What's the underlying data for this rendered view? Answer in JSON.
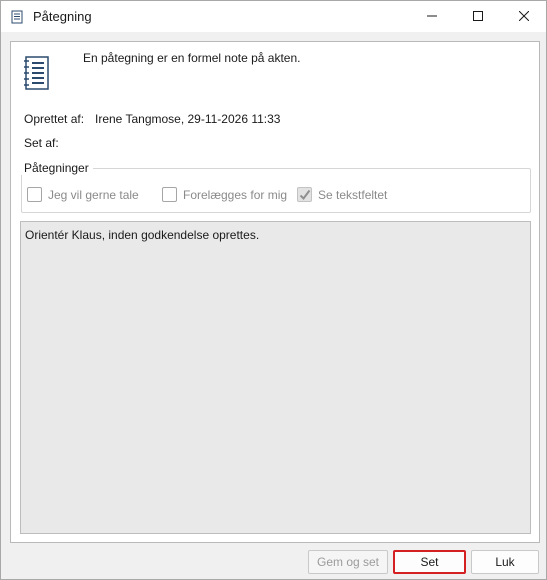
{
  "window": {
    "title": "Påtegning",
    "icons": {
      "app": "notepad-icon",
      "minimize": "minimize-icon",
      "maximize": "maximize-icon",
      "close": "close-icon"
    }
  },
  "header": {
    "icon": "notepad-icon",
    "intro": "En påtegning er en formel note på akten."
  },
  "details": {
    "created_by_label": "Oprettet af:",
    "created_by_value": "Irene Tangmose, 29-11-2026 11:33",
    "seen_by_label": "Set af:"
  },
  "annotations": {
    "legend": "Påtegninger",
    "options": [
      {
        "label": "Jeg vil gerne tale",
        "checked": false
      },
      {
        "label": "Forelægges for mig",
        "checked": false
      },
      {
        "label": "Se tekstfeltet",
        "checked": true
      }
    ]
  },
  "note_text": "Orientér Klaus, inden godkendelse oprettes.",
  "buttons": {
    "save_and_seen": "Gem og set",
    "seen": "Set",
    "close": "Luk"
  }
}
